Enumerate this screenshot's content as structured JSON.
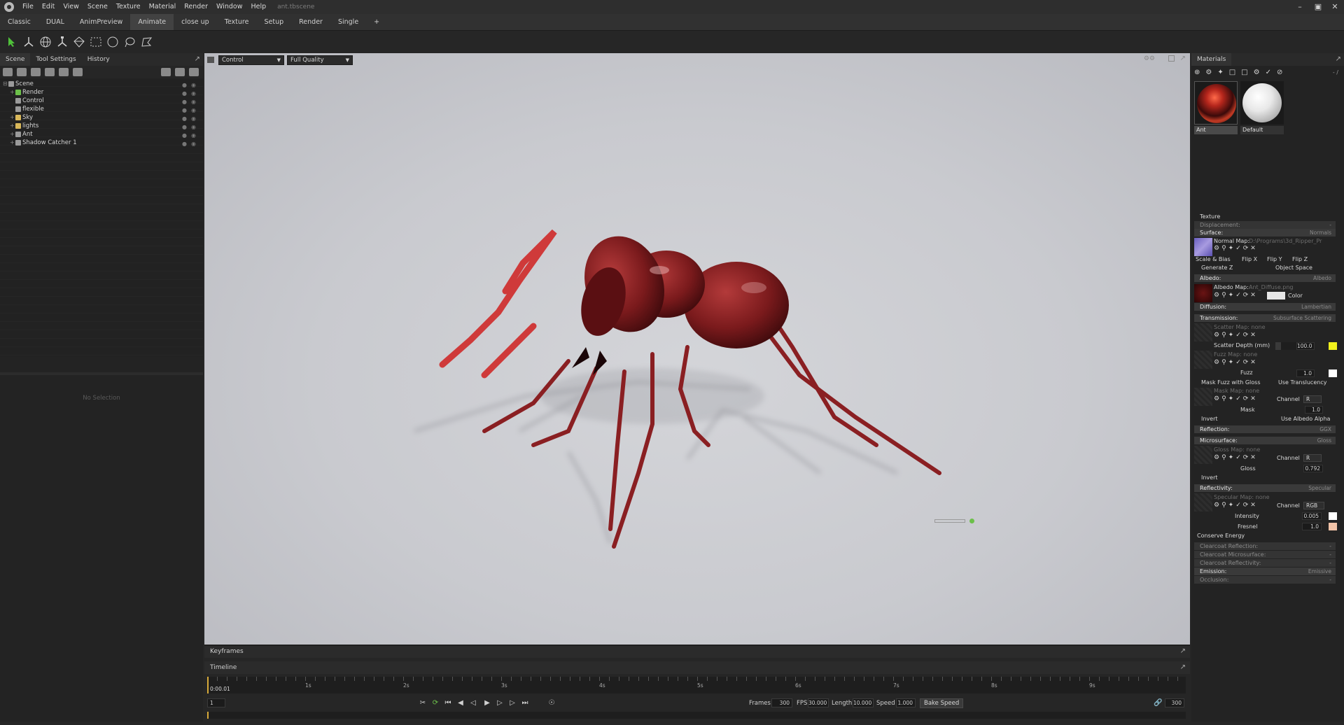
{
  "menubar": {
    "items": [
      "File",
      "Edit",
      "View",
      "Scene",
      "Texture",
      "Material",
      "Render",
      "Window",
      "Help"
    ],
    "doc_title": "ant.tbscene"
  },
  "workspace_tabs": {
    "items": [
      "Classic",
      "DUAL",
      "AnimPreview",
      "Animate",
      "close up",
      "Texture",
      "Setup",
      "Render",
      "Single",
      "+"
    ],
    "active": "Animate"
  },
  "left_panel": {
    "tabs": [
      "Scene",
      "Tool Settings",
      "History"
    ],
    "active_tab": "Scene",
    "tree": [
      {
        "label": "Scene",
        "color": "#9a9a9a"
      },
      {
        "label": "Render",
        "color": "#6cc04a"
      },
      {
        "label": "Control",
        "color": "#9a9a9a"
      },
      {
        "label": "flexible",
        "color": "#9a9a9a"
      },
      {
        "label": "Sky",
        "color": "#d9b85a"
      },
      {
        "label": "lights",
        "color": "#d9b85a"
      },
      {
        "label": "Ant",
        "color": "#9a9a9a"
      },
      {
        "label": "Shadow Catcher 1",
        "color": "#9a9a9a"
      }
    ],
    "no_selection": "No Selection"
  },
  "viewport": {
    "camera": "Control",
    "quality": "Full Quality"
  },
  "keyframes": {
    "label": "Keyframes"
  },
  "timeline": {
    "label": "Timeline",
    "time_display": "0:00.01",
    "tick_labels": [
      "1s",
      "2s",
      "3s",
      "4s",
      "5s",
      "6s",
      "7s",
      "8s",
      "9s"
    ],
    "current_frame": "1",
    "frames_label": "Frames",
    "frames": "300",
    "fps_label": "FPS",
    "fps": "30.000",
    "length_label": "Length",
    "length": "10.000",
    "speed_label": "Speed",
    "speed": "1.000",
    "bake_speed": "Bake Speed",
    "end_frame": "300"
  },
  "materials": {
    "title": "Materials",
    "slash_label": "- /",
    "items": [
      {
        "name": "Ant"
      },
      {
        "name": "Default"
      }
    ],
    "texture": "Texture",
    "displacement": "Displacement:",
    "surface": {
      "label": "Surface:",
      "mode": "Normals"
    },
    "normal_map": "Normal Map:",
    "normal_map_path": "D:\\Programs\\3d_Ripper_Pr",
    "scale_bias": "Scale & Bias",
    "flip_x": "Flip X",
    "flip_y": "Flip Y",
    "flip_z": "Flip Z",
    "generate_z": "Generate Z",
    "object_space": "Object Space",
    "albedo": {
      "label": "Albedo:",
      "mode": "Albedo"
    },
    "albedo_map": "Albedo Map:",
    "albedo_map_file": "Ant_Diffuse.png",
    "color": "Color",
    "diffusion": {
      "label": "Diffusion:",
      "mode": "Lambertian"
    },
    "transmission": {
      "label": "Transmission:",
      "mode": "Subsurface Scattering"
    },
    "scatter_map": "Scatter Map: none",
    "scatter_depth": "Scatter Depth (mm)",
    "scatter_depth_val": "100.0",
    "fuzz_map": "Fuzz Map: none",
    "fuzz": "Fuzz",
    "fuzz_val": "1.0",
    "mask_fuzz": "Mask Fuzz with Gloss",
    "use_translucency": "Use Translucency",
    "mask_map": "Mask Map: none",
    "channel": "Channel",
    "channel_r": "R",
    "mask": "Mask",
    "mask_val": "1.0",
    "invert": "Invert",
    "use_albedo_alpha": "Use Albedo Alpha",
    "reflection": {
      "label": "Reflection:",
      "mode": "GGX"
    },
    "microsurface": {
      "label": "Microsurface:",
      "mode": "Gloss"
    },
    "gloss_map": "Gloss Map: none",
    "gloss": "Gloss",
    "gloss_val": "0.792",
    "reflectivity": {
      "label": "Reflectivity:",
      "mode": "Specular"
    },
    "specular_map": "Specular Map: none",
    "channel_rgb": "RGB",
    "intensity": "Intensity",
    "intensity_val": "0.005",
    "fresnel": "Fresnel",
    "fresnel_val": "1.0",
    "conserve_energy": "Conserve Energy",
    "clearcoat_reflection": "Clearcoat Reflection:",
    "clearcoat_microsurface": "Clearcoat Microsurface:",
    "clearcoat_reflectivity": "Clearcoat Reflectivity:",
    "emission": {
      "label": "Emission:",
      "mode": "Emissive"
    },
    "occlusion": "Occlusion:",
    "dash": "-"
  },
  "colors": {
    "accent_green": "#6cc04a",
    "scatter_yellow": "#f2f21c",
    "fresnel_peach": "#f3c4a8",
    "ant_red": "#8e1e1e"
  }
}
